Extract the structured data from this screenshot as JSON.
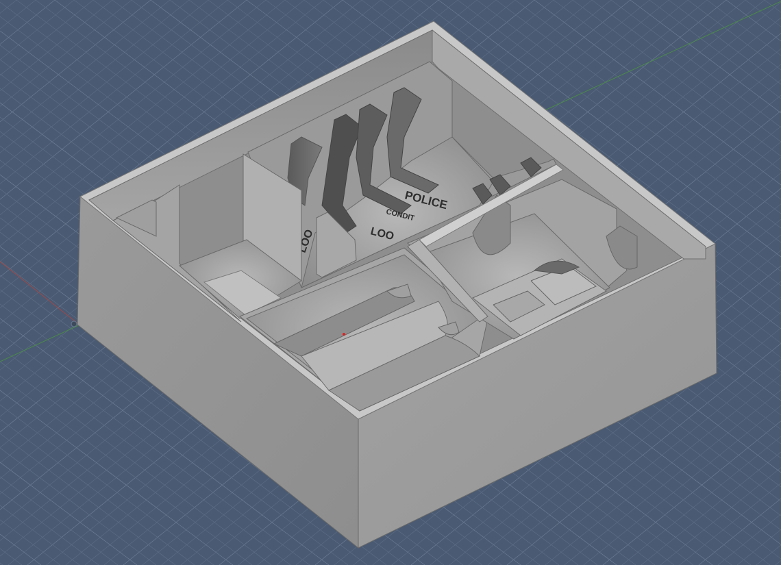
{
  "viewport": {
    "background_color": "#4a5a72",
    "grid_minor_color": "#5b6c84",
    "grid_major_color": "#6a7b93"
  },
  "axes": {
    "x_axis_color": "#a04848",
    "y_axis_color": "#4a8a4a"
  },
  "model": {
    "body_color": "#9c9c9c",
    "engraved_labels": [
      {
        "id": "police",
        "text": "POLICE"
      },
      {
        "id": "condit",
        "text": "CONDIT"
      },
      {
        "id": "loo-1",
        "text": "LOO"
      },
      {
        "id": "loo-2",
        "text": "LOO"
      }
    ]
  }
}
